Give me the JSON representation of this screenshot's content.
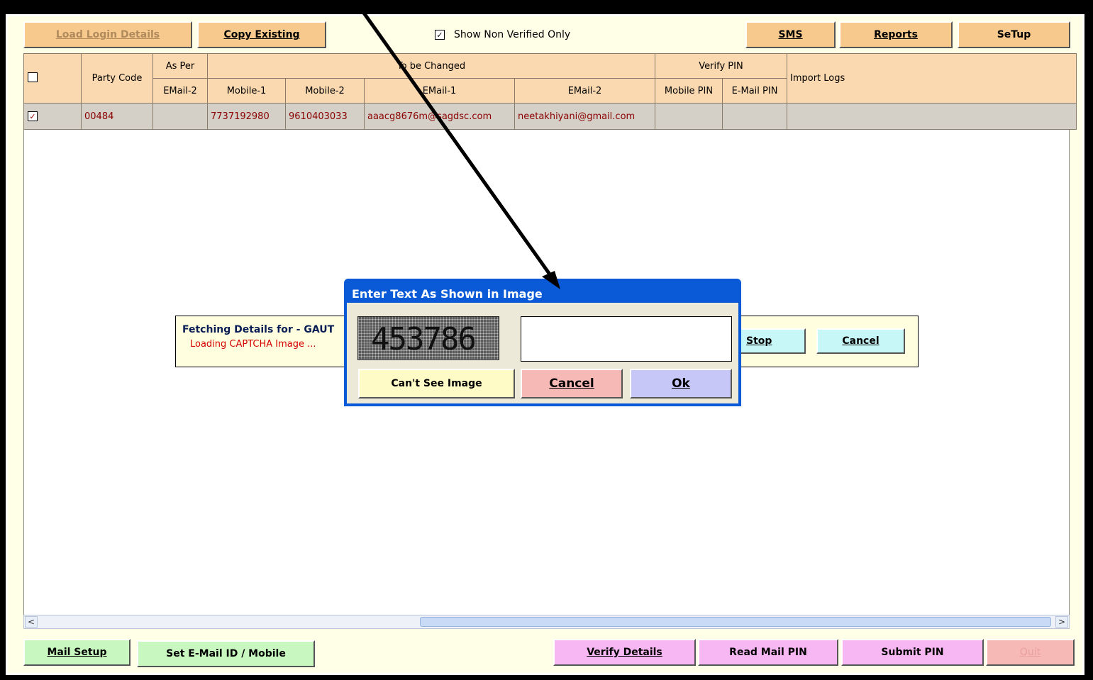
{
  "toolbar": {
    "load_login": "Load Login Details",
    "copy_existing": "Copy Existing",
    "show_non_verified": "Show Non Verified Only",
    "sms": "SMS",
    "reports": "Reports",
    "setup": "SeTup"
  },
  "grid": {
    "headers": {
      "party_code": "Party Code",
      "as_per": "As Per",
      "to_be_changed": "To be Changed",
      "verify_pin": "Verify PIN",
      "import_logs": "Import Logs",
      "email2_a": "EMail-2",
      "mobile1": "Mobile-1",
      "mobile2": "Mobile-2",
      "email1": "EMail-1",
      "email2_b": "EMail-2",
      "mobile_pin": "Mobile PIN",
      "email_pin": "E-Mail PIN"
    },
    "rows": [
      {
        "party_code": "00484",
        "as_per_email2": "",
        "mobile1": "7737192980",
        "mobile2": "9610403033",
        "email1": "aaacg8676m@sagdsc.com",
        "email2": "neetakhiyani@gmail.com",
        "mobile_pin": "",
        "email_pin": "",
        "import_logs": ""
      }
    ]
  },
  "status": {
    "fetching": "Fetching Details for - GAUT",
    "loading": "Loading CAPTCHA Image ...",
    "stop": "Stop",
    "cancel": "Cancel"
  },
  "dialog": {
    "title": "Enter Text As Shown in Image",
    "captcha_text": "453786",
    "input_value": "",
    "cant_see": "Can't See Image",
    "cancel": "Cancel",
    "ok": "Ok"
  },
  "bottom": {
    "mail_setup": "Mail Setup",
    "set_email": "Set E-Mail ID / Mobile",
    "verify_details": "Verify Details",
    "read_mail_pin": "Read Mail PIN",
    "submit_pin": "Submit PIN",
    "quit": "Quit"
  },
  "colors": {
    "header_bg": "#fbd9b0",
    "row_bg": "#d4d0c8",
    "dialog_title_bar": "#0a5ad8"
  }
}
